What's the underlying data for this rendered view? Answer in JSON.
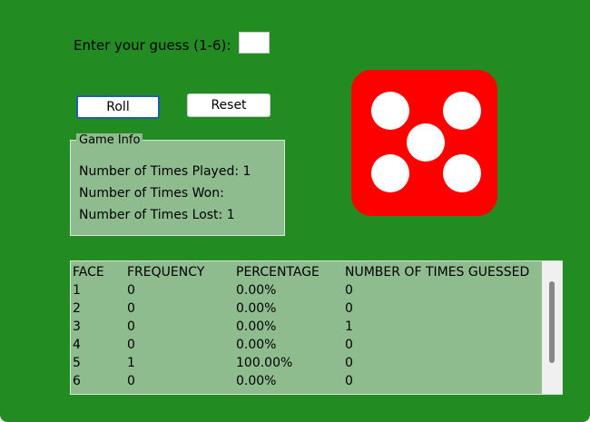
{
  "guess": {
    "label": "Enter your guess (1-6):",
    "value": "",
    "placeholder": ""
  },
  "buttons": {
    "roll": "Roll",
    "reset": "Reset"
  },
  "game_info": {
    "title": "Game Info",
    "played": "Number of Times Played: 1",
    "won": "Number of Times Won:",
    "lost": "Number of Times Lost: 1"
  },
  "die": {
    "face": 5,
    "color": "#ff0000",
    "pip_color": "#ffffff"
  },
  "table": {
    "headers": [
      "FACE",
      "FREQUENCY",
      "PERCENTAGE",
      "NUMBER OF TIMES GUESSED"
    ],
    "rows": [
      [
        "1",
        "0",
        "0.00%",
        "0"
      ],
      [
        "2",
        "0",
        "0.00%",
        "0"
      ],
      [
        "3",
        "0",
        "0.00%",
        "1"
      ],
      [
        "4",
        "0",
        "0.00%",
        "0"
      ],
      [
        "5",
        "1",
        "100.00%",
        "0"
      ],
      [
        "6",
        "0",
        "0.00%",
        "0"
      ]
    ]
  },
  "colors": {
    "background": "#228b22",
    "panel": "#8fbc8f"
  }
}
